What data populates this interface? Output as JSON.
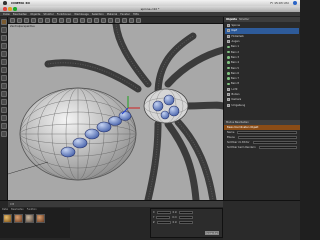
{
  "system": {
    "app_name": "CINEMA 4D",
    "clock": "Fr 15:03 Uhr"
  },
  "window": {
    "title": "spinne.c4d *"
  },
  "menu": [
    "Datei",
    "Bearbeiten",
    "Objekte",
    "Struktur",
    "Funktionen",
    "Werkzeuge",
    "Selektion",
    "Material",
    "Fenster",
    "Hilfe"
  ],
  "viewport": {
    "label": "Zentralperspektive"
  },
  "objects_panel": {
    "tabs": [
      "Objekte",
      "Struktur"
    ],
    "items": [
      {
        "label": "Spinne"
      },
      {
        "label": "Kopf"
      },
      {
        "label": "Hinterleib"
      },
      {
        "label": "Augen"
      },
      {
        "label": "Bein 1"
      },
      {
        "label": "Bein 2"
      },
      {
        "label": "Bein 3"
      },
      {
        "label": "Bein 4"
      },
      {
        "label": "Bein 5"
      },
      {
        "label": "Bein 6"
      },
      {
        "label": "Bein 7"
      },
      {
        "label": "Bein 8"
      },
      {
        "label": "Licht"
      },
      {
        "label": "Boden"
      },
      {
        "label": "Kamera"
      },
      {
        "label": "Umgebung"
      }
    ],
    "selected_index": 1
  },
  "attributes": {
    "header": "Modus  Bearbeiten",
    "rows": [
      "Basis  Koordinaten  Objekt",
      "Name",
      "Ebene",
      "Sichtbar im Editor",
      "Sichtbar beim Rendern"
    ]
  },
  "timeline": {
    "frame": "0 B"
  },
  "materials": {
    "tabs": [
      "Datei",
      "Bearbeiten",
      "Funktion"
    ]
  },
  "coordinates": {
    "rows": [
      {
        "axis": "X",
        "pos": "0 m",
        "size": "0 m",
        "rot": "0°"
      },
      {
        "axis": "Y",
        "pos": "0 m",
        "size": "0 m",
        "rot": "0°"
      },
      {
        "axis": "Z",
        "pos": "0 m",
        "size": "0 m",
        "rot": "0°"
      }
    ],
    "apply": "Anwenden"
  }
}
